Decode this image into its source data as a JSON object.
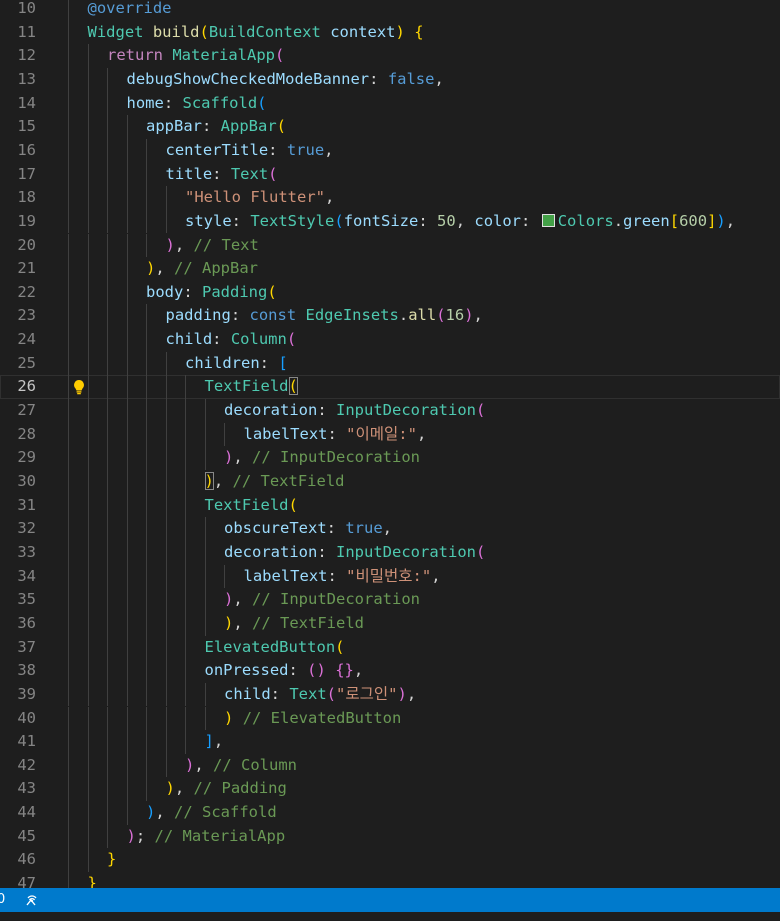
{
  "editor": {
    "language": "dart",
    "current_line": 26,
    "lines": [
      {
        "n": "10",
        "tokens": [
          [
            "kw",
            "@override"
          ]
        ]
      },
      {
        "n": "11",
        "tokens": [
          [
            "ty",
            "Widget"
          ],
          [
            "p",
            " "
          ],
          [
            "fn",
            "build"
          ],
          [
            "b1",
            "("
          ],
          [
            "ty",
            "BuildContext"
          ],
          [
            "p",
            " "
          ],
          [
            "prop",
            "context"
          ],
          [
            "b1",
            ")"
          ],
          [
            "p",
            " "
          ],
          [
            "b1",
            "{"
          ]
        ]
      },
      {
        "n": "12",
        "tokens": [
          [
            "kw2",
            "return"
          ],
          [
            "p",
            " "
          ],
          [
            "ty",
            "MaterialApp"
          ],
          [
            "b2",
            "("
          ]
        ]
      },
      {
        "n": "13",
        "tokens": [
          [
            "prop",
            "debugShowCheckedModeBanner"
          ],
          [
            "p",
            ": "
          ],
          [
            "kw",
            "false"
          ],
          [
            "p",
            ","
          ]
        ]
      },
      {
        "n": "14",
        "tokens": [
          [
            "prop",
            "home"
          ],
          [
            "p",
            ": "
          ],
          [
            "ty",
            "Scaffold"
          ],
          [
            "b3",
            "("
          ]
        ]
      },
      {
        "n": "15",
        "tokens": [
          [
            "prop",
            "appBar"
          ],
          [
            "p",
            ": "
          ],
          [
            "ty",
            "AppBar"
          ],
          [
            "b1",
            "("
          ]
        ]
      },
      {
        "n": "16",
        "tokens": [
          [
            "prop",
            "centerTitle"
          ],
          [
            "p",
            ": "
          ],
          [
            "kw",
            "true"
          ],
          [
            "p",
            ","
          ]
        ]
      },
      {
        "n": "17",
        "tokens": [
          [
            "prop",
            "title"
          ],
          [
            "p",
            ": "
          ],
          [
            "ty",
            "Text"
          ],
          [
            "b2",
            "("
          ]
        ]
      },
      {
        "n": "18",
        "tokens": [
          [
            "str",
            "\"Hello Flutter\""
          ],
          [
            "p",
            ","
          ]
        ]
      },
      {
        "n": "19",
        "tokens": [
          [
            "prop",
            "style"
          ],
          [
            "p",
            ": "
          ],
          [
            "ty",
            "TextStyle"
          ],
          [
            "b3",
            "("
          ],
          [
            "prop",
            "fontSize"
          ],
          [
            "p",
            ": "
          ],
          [
            "num",
            "50"
          ],
          [
            "p",
            ", "
          ],
          [
            "prop",
            "color"
          ],
          [
            "p",
            ": "
          ],
          [
            "swatch",
            ""
          ],
          [
            "ty",
            "Colors"
          ],
          [
            "p",
            "."
          ],
          [
            "prop",
            "green"
          ],
          [
            "b1",
            "["
          ],
          [
            "num",
            "600"
          ],
          [
            "b1",
            "]"
          ],
          [
            "b3",
            ")"
          ],
          [
            "p",
            ","
          ]
        ]
      },
      {
        "n": "20",
        "tokens": [
          [
            "b2",
            ")"
          ],
          [
            "p",
            ", "
          ],
          [
            "cm",
            "// Text"
          ]
        ]
      },
      {
        "n": "21",
        "tokens": [
          [
            "b1",
            ")"
          ],
          [
            "p",
            ", "
          ],
          [
            "cm",
            "// AppBar"
          ]
        ]
      },
      {
        "n": "22",
        "tokens": [
          [
            "prop",
            "body"
          ],
          [
            "p",
            ": "
          ],
          [
            "ty",
            "Padding"
          ],
          [
            "b1",
            "("
          ]
        ]
      },
      {
        "n": "23",
        "tokens": [
          [
            "prop",
            "padding"
          ],
          [
            "p",
            ": "
          ],
          [
            "kw",
            "const"
          ],
          [
            "p",
            " "
          ],
          [
            "ty",
            "EdgeInsets"
          ],
          [
            "p",
            "."
          ],
          [
            "fn",
            "all"
          ],
          [
            "b2",
            "("
          ],
          [
            "num",
            "16"
          ],
          [
            "b2",
            ")"
          ],
          [
            "p",
            ","
          ]
        ]
      },
      {
        "n": "24",
        "tokens": [
          [
            "prop",
            "child"
          ],
          [
            "p",
            ": "
          ],
          [
            "ty",
            "Column"
          ],
          [
            "b2",
            "("
          ]
        ]
      },
      {
        "n": "25",
        "tokens": [
          [
            "prop",
            "children"
          ],
          [
            "p",
            ": "
          ],
          [
            "b3",
            "["
          ]
        ]
      },
      {
        "n": "26",
        "tokens": [
          [
            "ty",
            "TextField"
          ],
          [
            "b1bm",
            "("
          ],
          [
            "caret",
            ""
          ]
        ]
      },
      {
        "n": "27",
        "tokens": [
          [
            "prop",
            "decoration"
          ],
          [
            "p",
            ": "
          ],
          [
            "ty",
            "InputDecoration"
          ],
          [
            "b2",
            "("
          ]
        ]
      },
      {
        "n": "28",
        "tokens": [
          [
            "prop",
            "labelText"
          ],
          [
            "p",
            ": "
          ],
          [
            "str",
            "\"이메일:\""
          ],
          [
            "p",
            ","
          ]
        ]
      },
      {
        "n": "29",
        "tokens": [
          [
            "b2",
            ")"
          ],
          [
            "p",
            ", "
          ],
          [
            "cm",
            "// InputDecoration"
          ]
        ]
      },
      {
        "n": "30",
        "tokens": [
          [
            "b1bm",
            ")"
          ],
          [
            "p",
            ", "
          ],
          [
            "cm",
            "// TextField"
          ]
        ]
      },
      {
        "n": "31",
        "tokens": [
          [
            "ty",
            "TextField"
          ],
          [
            "b1",
            "("
          ]
        ]
      },
      {
        "n": "32",
        "tokens": [
          [
            "prop",
            "obscureText"
          ],
          [
            "p",
            ": "
          ],
          [
            "kw",
            "true"
          ],
          [
            "p",
            ","
          ]
        ]
      },
      {
        "n": "33",
        "tokens": [
          [
            "prop",
            "decoration"
          ],
          [
            "p",
            ": "
          ],
          [
            "ty",
            "InputDecoration"
          ],
          [
            "b2",
            "("
          ]
        ]
      },
      {
        "n": "34",
        "tokens": [
          [
            "prop",
            "labelText"
          ],
          [
            "p",
            ": "
          ],
          [
            "str",
            "\"비밀번호:\""
          ],
          [
            "p",
            ","
          ]
        ]
      },
      {
        "n": "35",
        "tokens": [
          [
            "b2",
            ")"
          ],
          [
            "p",
            ", "
          ],
          [
            "cm",
            "// InputDecoration"
          ]
        ]
      },
      {
        "n": "36",
        "tokens": [
          [
            "b1",
            ")"
          ],
          [
            "p",
            ", "
          ],
          [
            "cm",
            "// TextField"
          ]
        ]
      },
      {
        "n": "37",
        "tokens": [
          [
            "ty",
            "ElevatedButton"
          ],
          [
            "b1",
            "("
          ]
        ]
      },
      {
        "n": "38",
        "tokens": [
          [
            "prop",
            "onPressed"
          ],
          [
            "p",
            ": "
          ],
          [
            "b2",
            "()"
          ],
          [
            "p",
            " "
          ],
          [
            "b2",
            "{}"
          ],
          [
            "p",
            ","
          ]
        ]
      },
      {
        "n": "39",
        "tokens": [
          [
            "prop",
            "child"
          ],
          [
            "p",
            ": "
          ],
          [
            "ty",
            "Text"
          ],
          [
            "b2",
            "("
          ],
          [
            "str",
            "\"로그인\""
          ],
          [
            "b2",
            ")"
          ],
          [
            "p",
            ","
          ]
        ]
      },
      {
        "n": "40",
        "tokens": [
          [
            "b1",
            ")"
          ],
          [
            "p",
            " "
          ],
          [
            "cm",
            "// ElevatedButton"
          ]
        ]
      },
      {
        "n": "41",
        "tokens": [
          [
            "b3",
            "]"
          ],
          [
            "p",
            ","
          ]
        ]
      },
      {
        "n": "42",
        "tokens": [
          [
            "b2",
            ")"
          ],
          [
            "p",
            ", "
          ],
          [
            "cm",
            "// Column"
          ]
        ]
      },
      {
        "n": "43",
        "tokens": [
          [
            "b1",
            ")"
          ],
          [
            "p",
            ", "
          ],
          [
            "cm",
            "// Padding"
          ]
        ]
      },
      {
        "n": "44",
        "tokens": [
          [
            "b3",
            ")"
          ],
          [
            "p",
            ", "
          ],
          [
            "cm",
            "// Scaffold"
          ]
        ]
      },
      {
        "n": "45",
        "tokens": [
          [
            "b2",
            ")"
          ],
          [
            "p",
            "; "
          ],
          [
            "cm",
            "// MaterialApp"
          ]
        ]
      },
      {
        "n": "46",
        "tokens": [
          [
            "b1",
            "}"
          ]
        ]
      },
      {
        "n": "47",
        "tokens": [
          [
            "b1",
            "}"
          ]
        ]
      }
    ]
  },
  "statusbar": {
    "left_count": "0",
    "live_share_icon": "broadcast-icon"
  }
}
